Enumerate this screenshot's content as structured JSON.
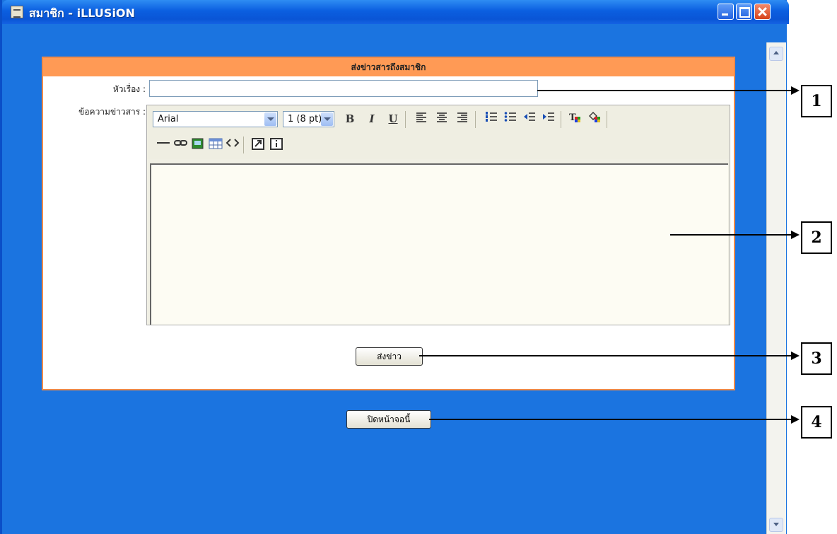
{
  "window": {
    "title": "สมาชิก - iLLUSiON"
  },
  "panel": {
    "header": "ส่งข่าวสารถึงสมาชิก",
    "subject_label": "หัวเรื่อง :",
    "subject_value": "",
    "message_label": "ข้อความข่าวสาร :",
    "editor": {
      "font_family": "Arial",
      "font_size": "1 (8 pt)",
      "bold": "B",
      "italic": "I",
      "underline": "U",
      "content": ""
    },
    "send_button": "ส่งข่าว"
  },
  "close_button": "ปิดหน้าจอนี้",
  "callouts": [
    "1",
    "2",
    "3",
    "4"
  ],
  "colors": {
    "window_bg": "#1b74e0",
    "panel_header": "#ff9a55",
    "panel_border": "#f08a48",
    "editor_bg": "#fdfcf3"
  }
}
